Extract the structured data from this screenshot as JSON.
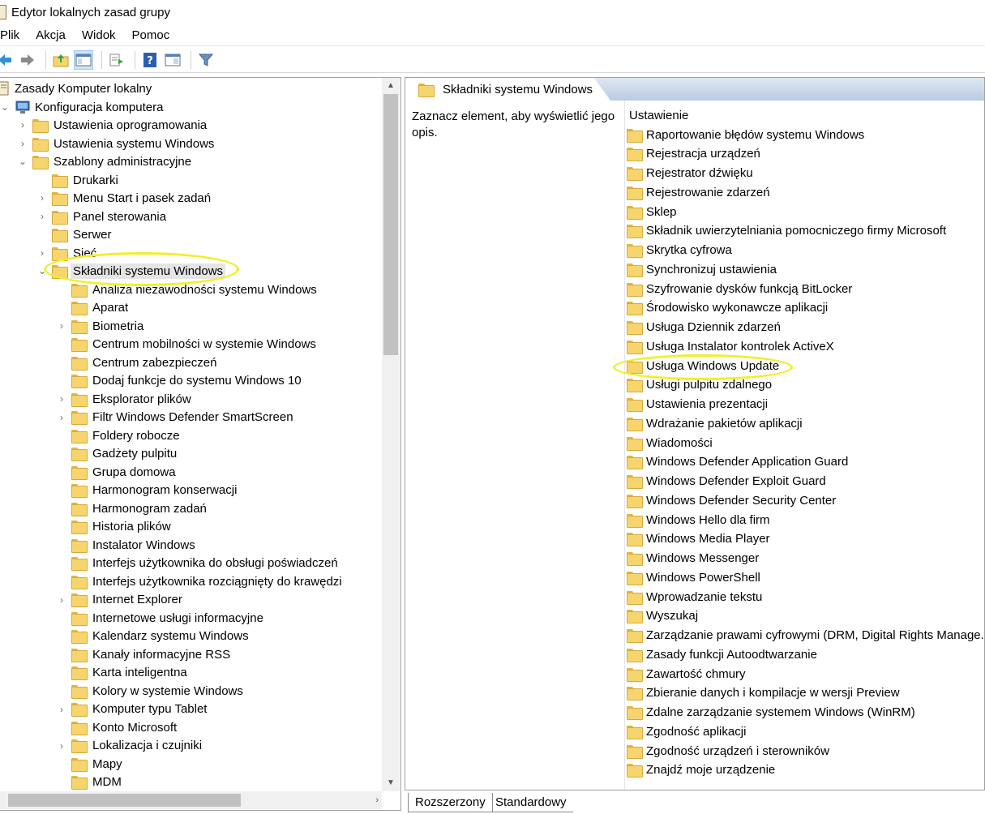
{
  "window": {
    "title": "Edytor lokalnych zasad grupy"
  },
  "menu": [
    "Plik",
    "Akcja",
    "Widok",
    "Pomoc"
  ],
  "toolbar": {
    "icons": [
      "back-arrow-icon",
      "forward-arrow-icon",
      "up-folder-icon",
      "show-hide-tree-icon",
      "export-list-icon",
      "help-icon",
      "properties-view-icon",
      "filter-icon"
    ]
  },
  "tree": {
    "root": "Zasady Komputer lokalny",
    "computer_config": "Konfiguracja komputera",
    "software_settings": "Ustawienia oprogramowania",
    "windows_settings": "Ustawienia systemu Windows",
    "admin_templates": "Szablony administracyjne",
    "printers": "Drukarki",
    "start_menu": "Menu Start i pasek zadań",
    "control_panel": "Panel sterowania",
    "server": "Serwer",
    "network": "Sieć",
    "windows_components": "Składniki systemu Windows",
    "components": [
      {
        "label": "Analiza niezawodności systemu Windows",
        "expandable": false
      },
      {
        "label": "Aparat",
        "expandable": false
      },
      {
        "label": "Biometria",
        "expandable": true
      },
      {
        "label": "Centrum mobilności w systemie Windows",
        "expandable": false
      },
      {
        "label": "Centrum zabezpieczeń",
        "expandable": false
      },
      {
        "label": "Dodaj funkcje do systemu Windows 10",
        "expandable": false
      },
      {
        "label": "Eksplorator plików",
        "expandable": true
      },
      {
        "label": "Filtr Windows Defender SmartScreen",
        "expandable": true
      },
      {
        "label": "Foldery robocze",
        "expandable": false
      },
      {
        "label": "Gadżety pulpitu",
        "expandable": false
      },
      {
        "label": "Grupa domowa",
        "expandable": false
      },
      {
        "label": "Harmonogram konserwacji",
        "expandable": false
      },
      {
        "label": "Harmonogram zadań",
        "expandable": false
      },
      {
        "label": "Historia plików",
        "expandable": false
      },
      {
        "label": "Instalator Windows",
        "expandable": false
      },
      {
        "label": "Interfejs użytkownika do obsługi poświadczeń",
        "expandable": false
      },
      {
        "label": "Interfejs użytkownika rozciągnięty do krawędzi",
        "expandable": false
      },
      {
        "label": "Internet Explorer",
        "expandable": true
      },
      {
        "label": "Internetowe usługi informacyjne",
        "expandable": false
      },
      {
        "label": "Kalendarz systemu Windows",
        "expandable": false
      },
      {
        "label": "Kanały informacyjne RSS",
        "expandable": false
      },
      {
        "label": "Karta inteligentna",
        "expandable": false
      },
      {
        "label": "Kolory w systemie Windows",
        "expandable": false
      },
      {
        "label": "Komputer typu Tablet",
        "expandable": true
      },
      {
        "label": "Konto Microsoft",
        "expandable": false
      },
      {
        "label": "Lokalizacja i czujniki",
        "expandable": true
      },
      {
        "label": "Mapy",
        "expandable": false
      },
      {
        "label": "MDM",
        "expandable": false
      }
    ]
  },
  "right": {
    "header_title": "Składniki systemu Windows",
    "description": "Zaznacz element, aby wyświetlić jego opis.",
    "column_header": "Ustawienie",
    "settings": [
      "Raportowanie błędów systemu Windows",
      "Rejestracja urządzeń",
      "Rejestrator dźwięku",
      "Rejestrowanie zdarzeń",
      "Sklep",
      "Składnik uwierzytelniania pomocniczego firmy Microsoft",
      "Skrytka cyfrowa",
      "Synchronizuj ustawienia",
      "Szyfrowanie dysków funkcją BitLocker",
      "Środowisko wykonawcze aplikacji",
      "Usługa Dziennik zdarzeń",
      "Usługa Instalator kontrolek ActiveX",
      "Usługa Windows Update",
      "Usługi pulpitu zdalnego",
      "Ustawienia prezentacji",
      "Wdrażanie pakietów aplikacji",
      "Wiadomości",
      "Windows Defender Application Guard",
      "Windows Defender Exploit Guard",
      "Windows Defender Security Center",
      "Windows Hello dla firm",
      "Windows Media Player",
      "Windows Messenger",
      "Windows PowerShell",
      "Wprowadzanie tekstu",
      "Wyszukaj",
      "Zarządzanie prawami cyfrowymi (DRM, Digital Rights Manage...",
      "Zasady funkcji Autoodtwarzanie",
      "Zawartość chmury",
      "Zbieranie danych i kompilacje w wersji Preview",
      "Zdalne zarządzanie systemem Windows (WinRM)",
      "Zgodność aplikacji",
      "Zgodność urządzeń i sterowników",
      "Znajdź moje urządzenie"
    ]
  },
  "bottom_tabs": [
    "Rozszerzony",
    "Standardowy"
  ],
  "colors": {
    "highlight_ellipse": "#f2ef2a",
    "folder": "#f6d56e",
    "header_gradient": "#b9cce2"
  }
}
